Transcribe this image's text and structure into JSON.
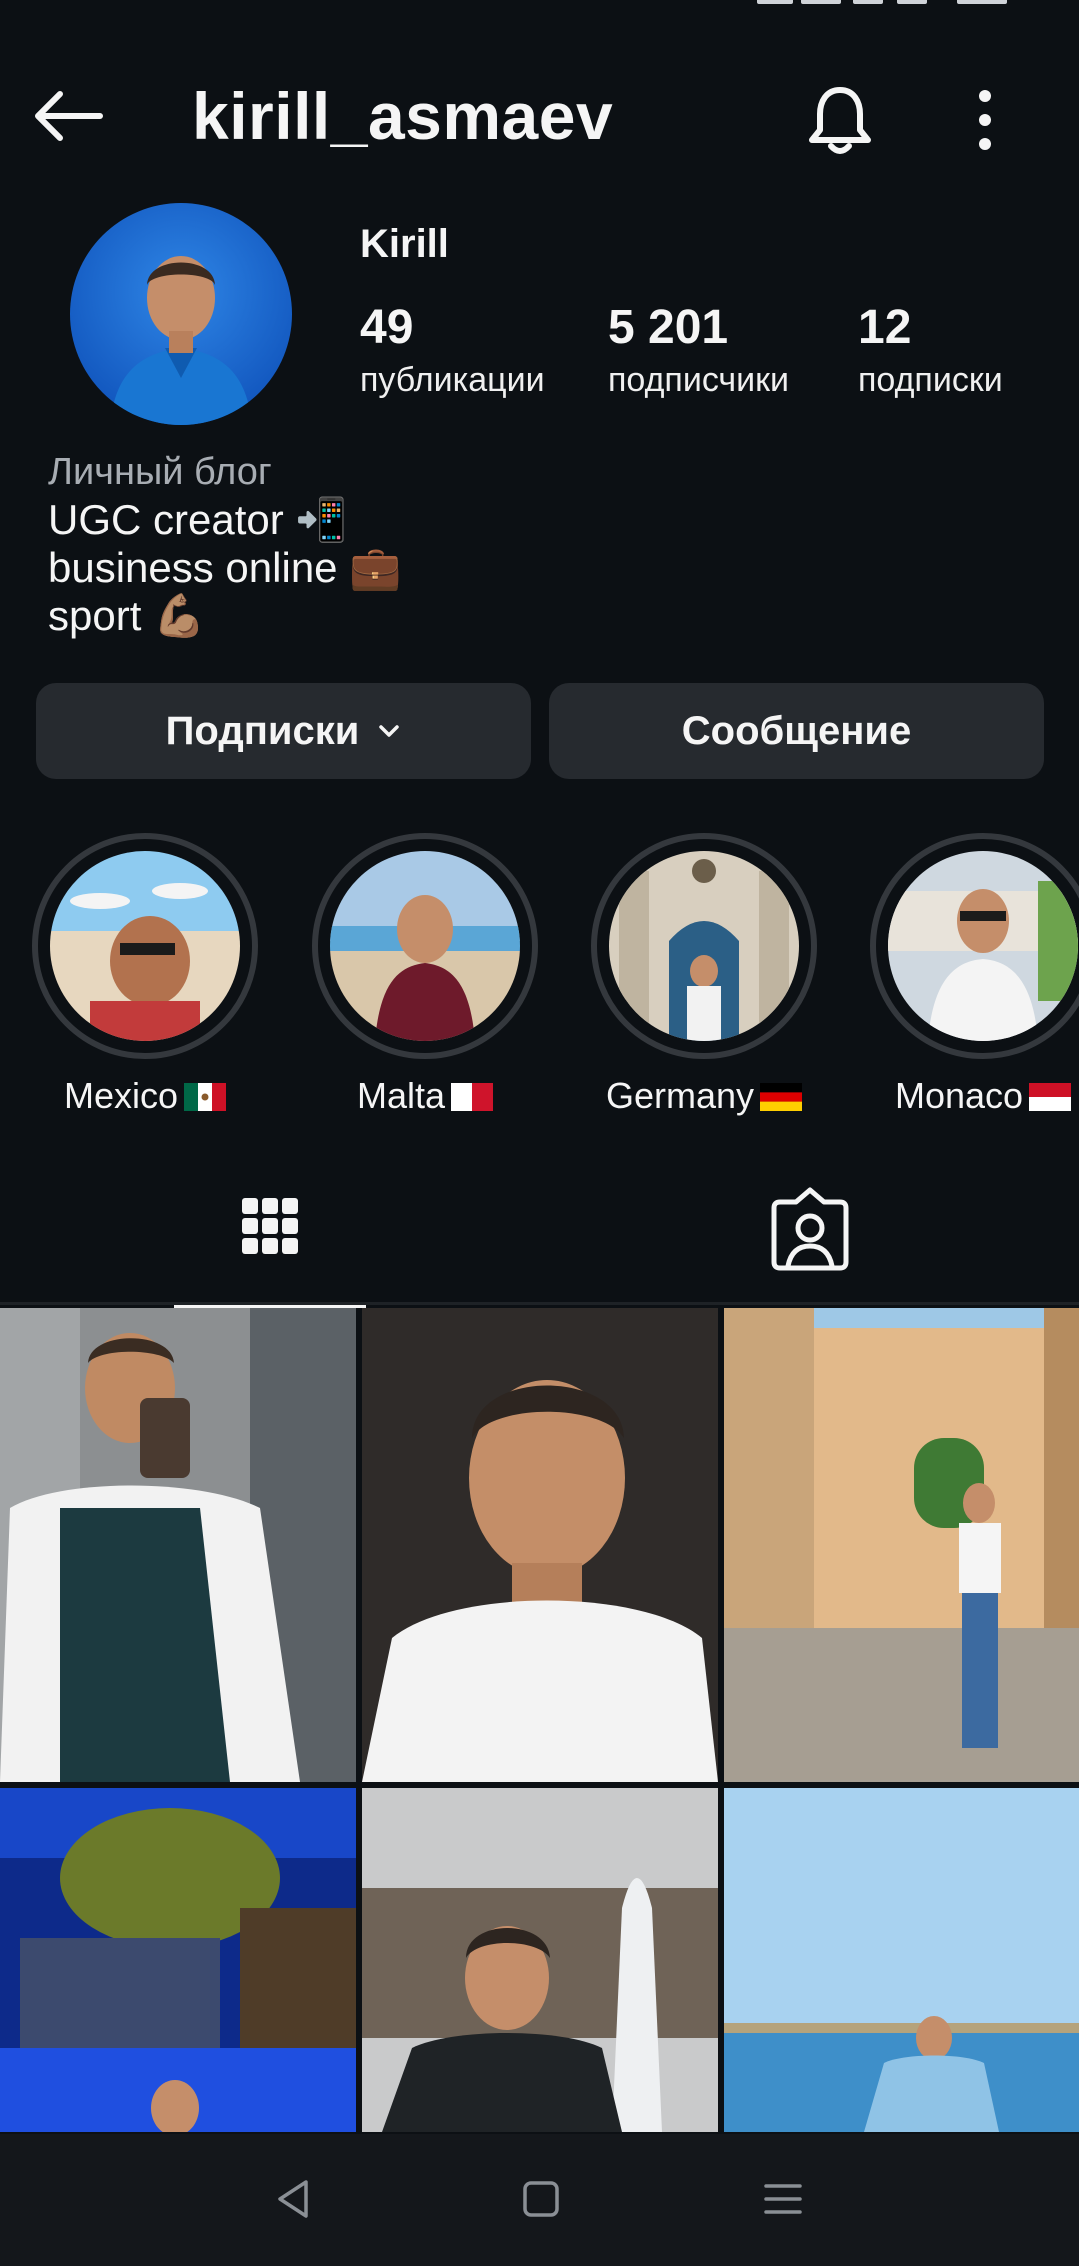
{
  "header": {
    "username": "kirill_asmaev",
    "back_icon": "arrow-left-icon",
    "bell_icon": "bell-icon",
    "more_icon": "more-vertical-icon"
  },
  "profile": {
    "display_name": "Kirill",
    "stats": [
      {
        "value": "49",
        "label": "публикации"
      },
      {
        "value": "5 201",
        "label": "подписчики"
      },
      {
        "value": "12",
        "label": "подписки"
      }
    ]
  },
  "bio": {
    "category": "Личный блог",
    "lines": [
      "UGC creator 📲",
      "business online 💼",
      "sport 💪🏽"
    ]
  },
  "actions": {
    "following_label": "Подписки",
    "message_label": "Сообщение"
  },
  "highlights": [
    {
      "label": "Mexico",
      "flag": "mexico"
    },
    {
      "label": "Malta",
      "flag": "malta"
    },
    {
      "label": "Germany",
      "flag": "germany"
    },
    {
      "label": "Monaco",
      "flag": "monaco"
    }
  ],
  "tabs": {
    "active": "grid",
    "items": [
      "grid-icon",
      "tagged-icon"
    ]
  },
  "colors": {
    "background": "#0c1014",
    "button_bg": "#262a2f",
    "text": "#f5f5f5",
    "secondary_text": "#a8adb3"
  }
}
